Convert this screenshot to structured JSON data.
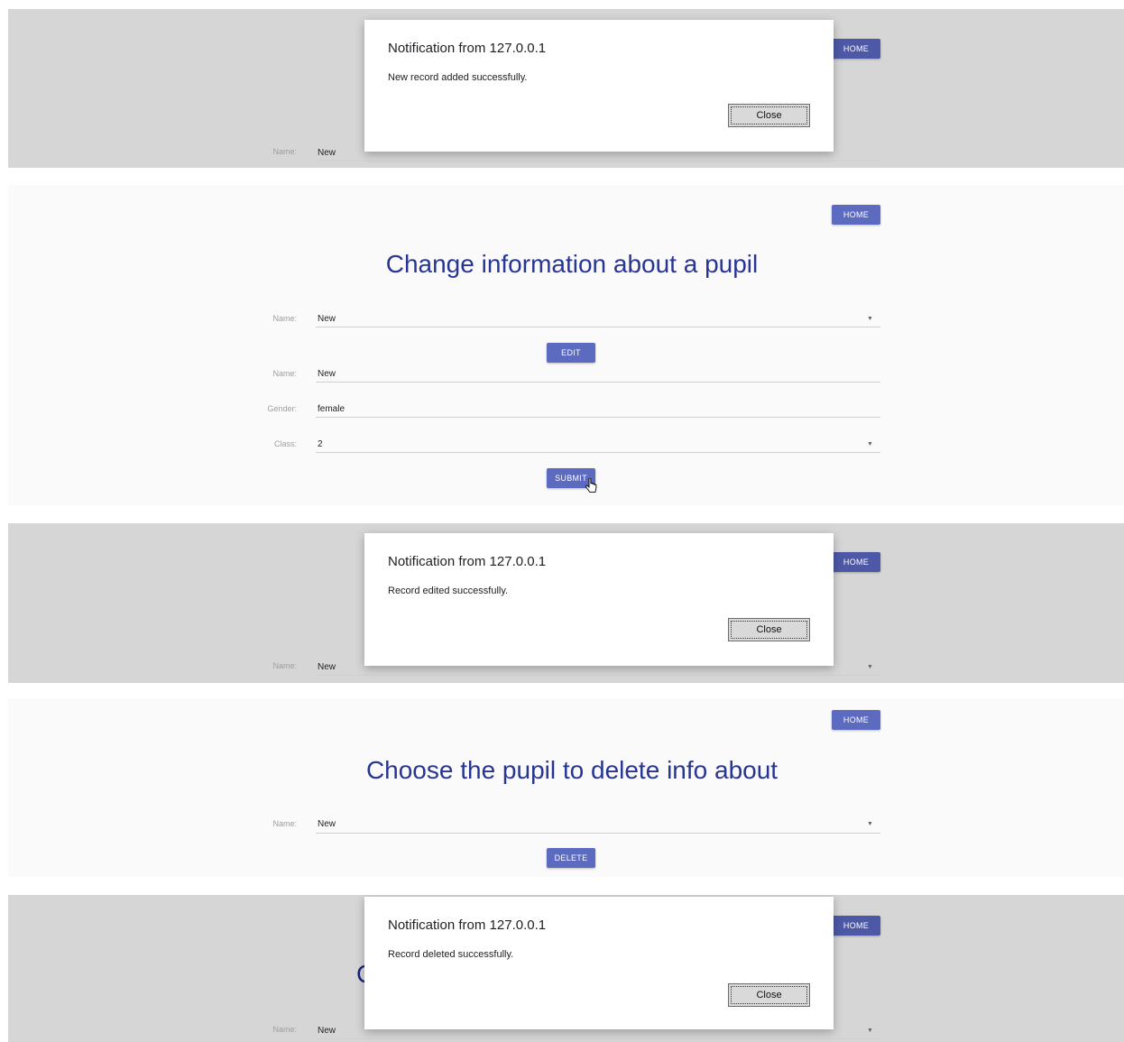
{
  "common": {
    "home_label": "HOME",
    "name_label": "Name:",
    "gender_label": "Gender:",
    "class_label": "Class:",
    "close_label": "Close",
    "notification_title": "Notification from 127.0.0.1"
  },
  "panel1": {
    "message": "New record added successfully.",
    "name_value": "New"
  },
  "panel2": {
    "title": "Change information about a pupil",
    "select_name_value": "New",
    "edit_label": "EDIT",
    "name_value": "New",
    "gender_value": "female",
    "class_value": "2",
    "submit_label": "SUBMIT"
  },
  "panel3": {
    "message": "Record edited successfully.",
    "name_value": "New"
  },
  "panel4": {
    "title": "Choose the pupil to delete info about",
    "name_value": "New",
    "delete_label": "DELETE"
  },
  "panel5": {
    "message": "Record deleted successfully.",
    "name_value": "New",
    "partial_title_char": "C"
  },
  "colors": {
    "accent": "#5c6bc0",
    "heading": "#283593",
    "dim_bg": "#d6d6d6"
  },
  "icons": {
    "dropdown": "caret-down-icon",
    "pointer": "hand-cursor-icon"
  }
}
